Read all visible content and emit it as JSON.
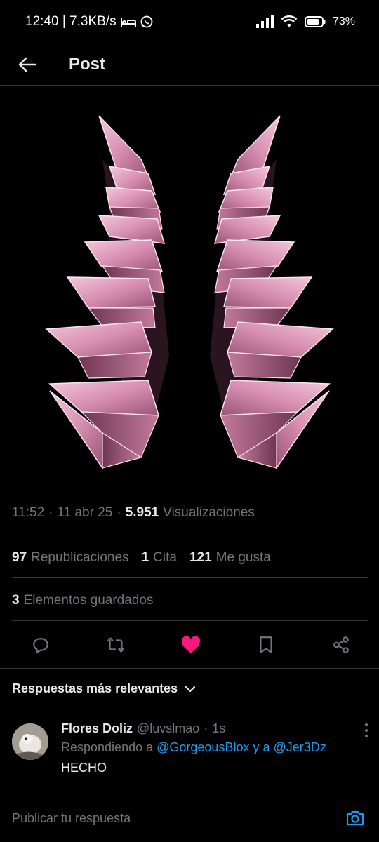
{
  "status_bar": {
    "time_net": "12:40 | 7,3KB/s",
    "battery": "73%"
  },
  "header": {
    "title": "Post"
  },
  "post": {
    "time": "11:52",
    "date": "11 abr 25",
    "views_count": "5.951",
    "views_label": "Visualizaciones",
    "reposts_count": "97",
    "reposts_label": "Republicaciones",
    "quotes_count": "1",
    "quotes_label": "Cita",
    "likes_count": "121",
    "likes_label": "Me gusta",
    "bookmarks_count": "3",
    "bookmarks_label": "Elementos guardados"
  },
  "colors": {
    "accent": "#1d9bf0",
    "like": "#f91880",
    "muted": "#71767b",
    "horn_pink": "#d99ab8"
  },
  "replies": {
    "sort_label": "Respuestas más relevantes",
    "items": [
      {
        "name": "Flores Doliz",
        "handle": "@luvslmao",
        "time": "1s",
        "replying_prefix": "Respondiendo a",
        "mention1": "@GorgeousBlox",
        "joiner": "y a",
        "mention2": "@Jer3Dz",
        "text": "HECHO"
      }
    ]
  },
  "compose": {
    "placeholder": "Publicar tu respuesta"
  },
  "icons": [
    "arrow-left-icon",
    "reply-icon",
    "repost-icon",
    "heart-icon",
    "bookmark-icon",
    "share-icon",
    "chevron-down-icon",
    "more-vertical-icon",
    "camera-icon",
    "wifi-icon",
    "signal-icon",
    "battery-icon",
    "bed-icon",
    "whatsapp-icon"
  ]
}
